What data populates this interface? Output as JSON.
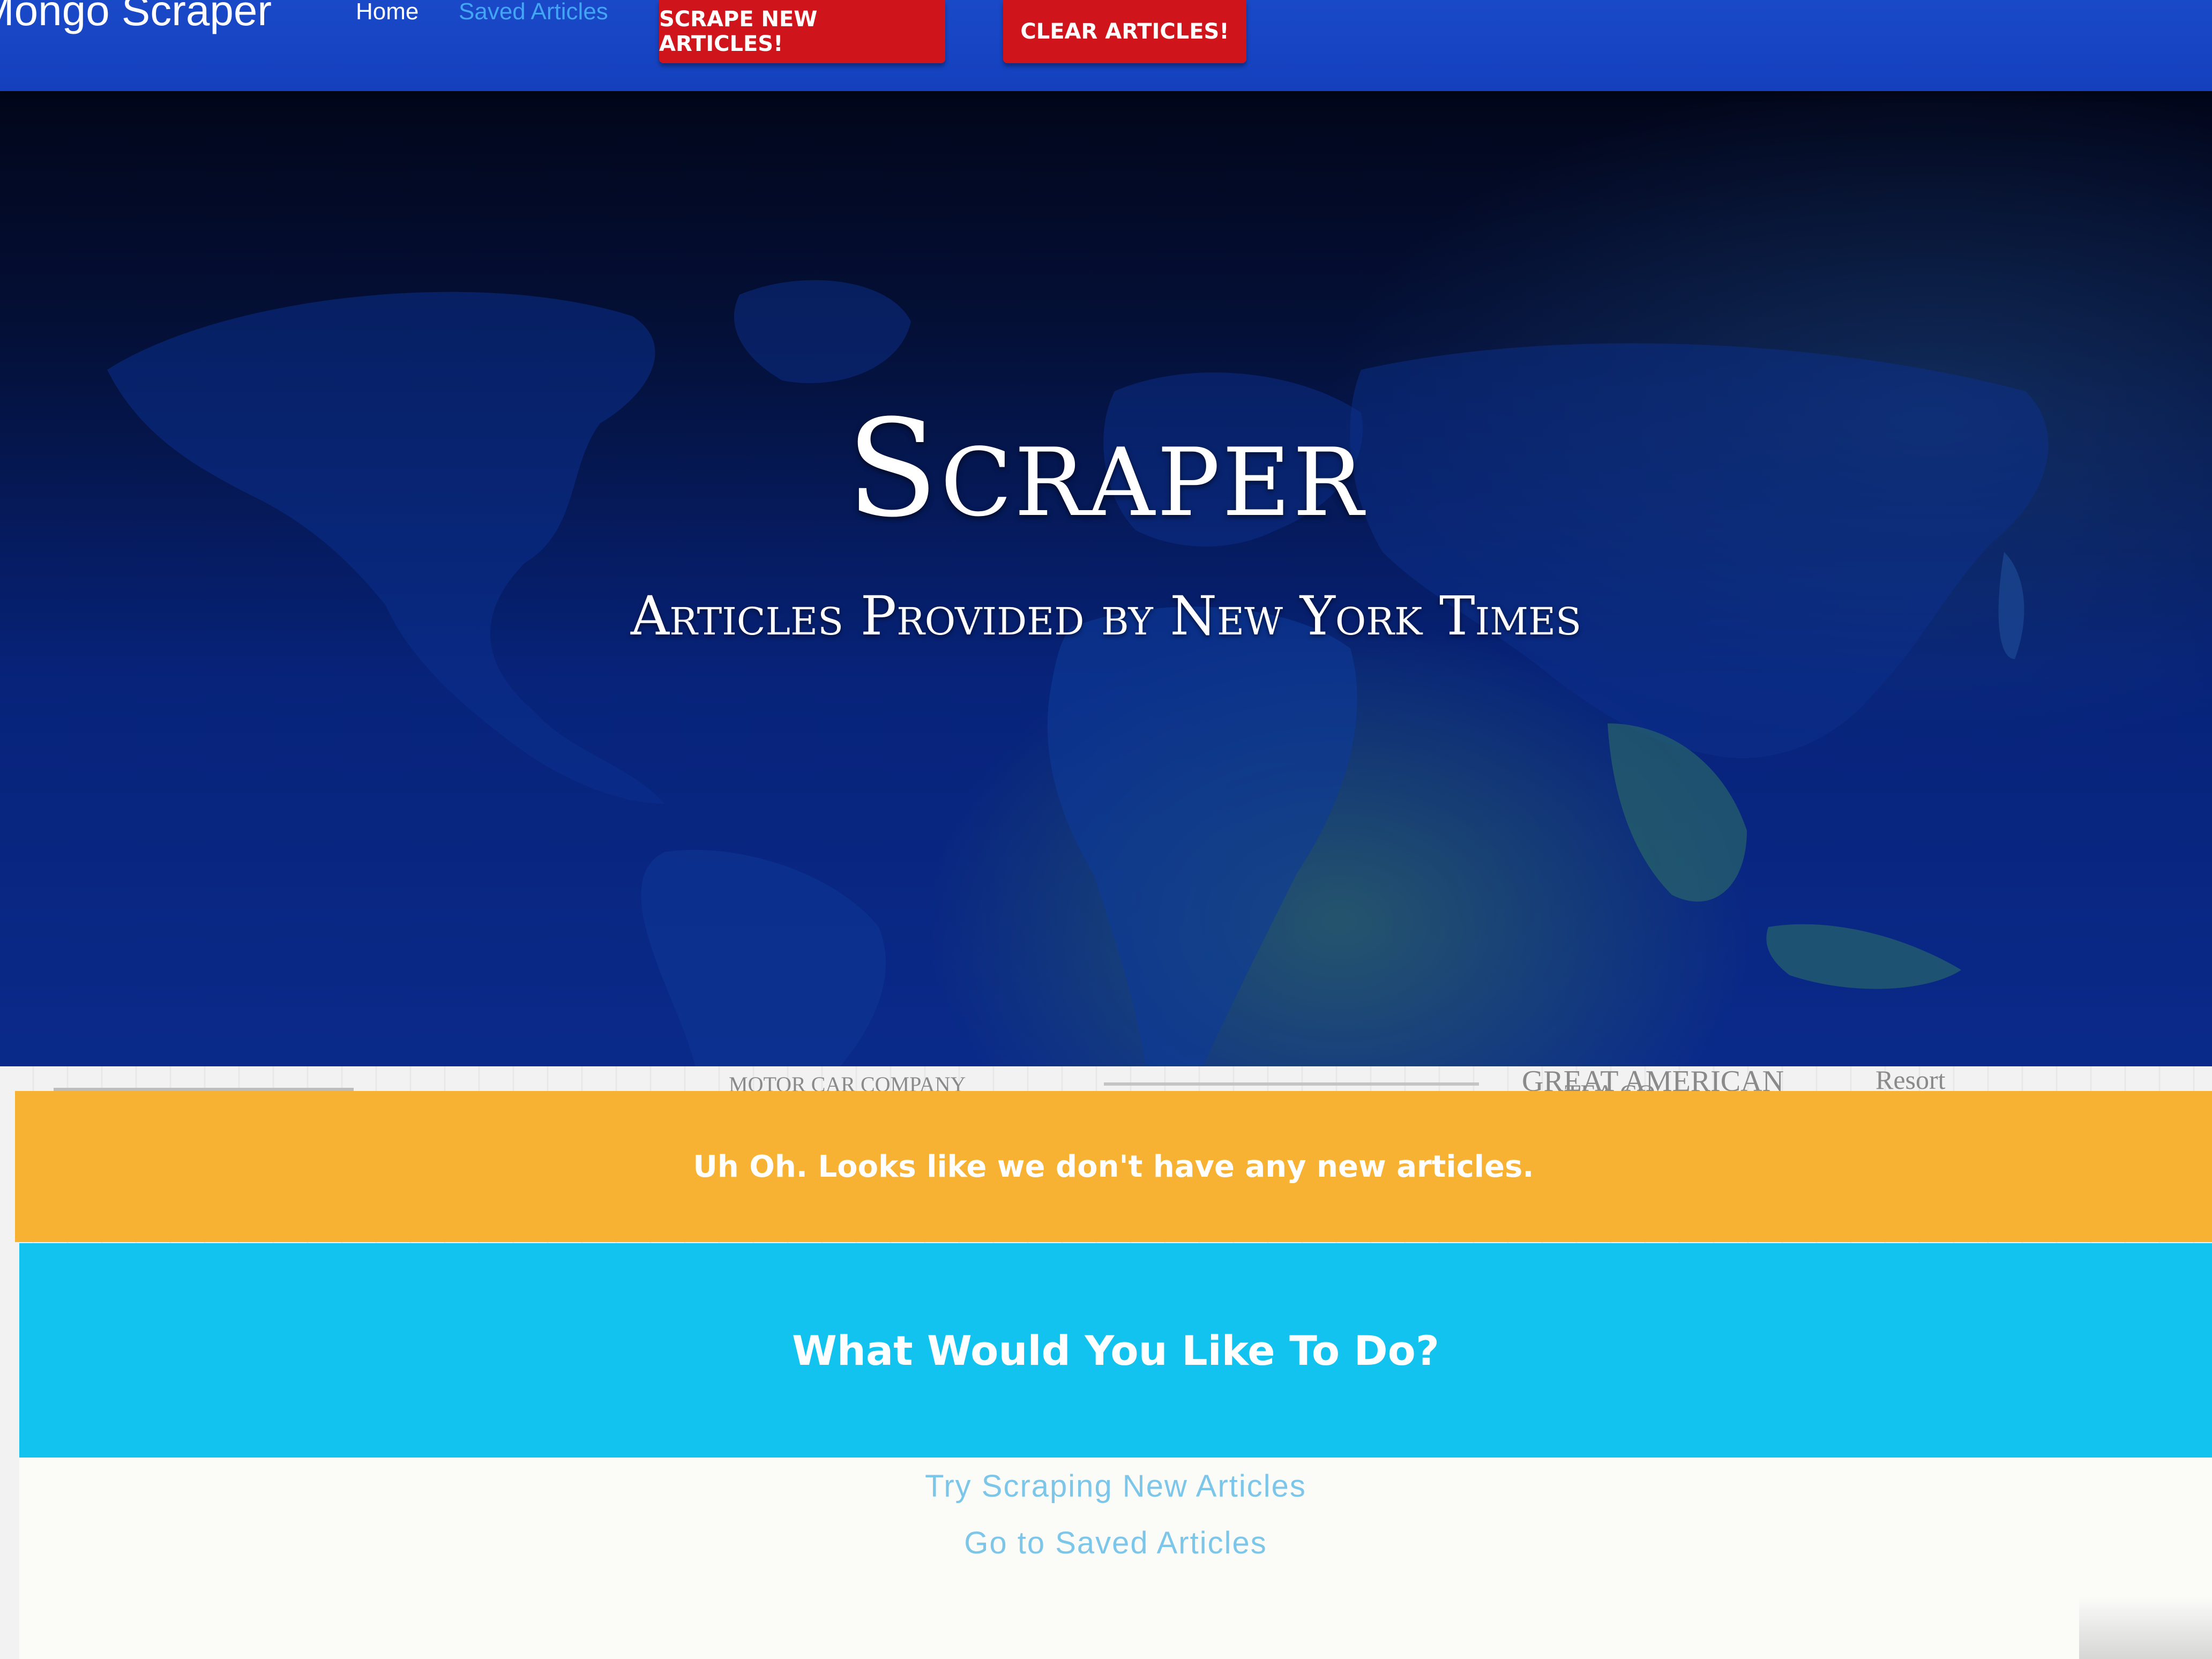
{
  "navbar": {
    "brand": "Mongo Scraper",
    "links": [
      {
        "label": "Home"
      },
      {
        "label": "Saved Articles"
      }
    ],
    "buttons": {
      "scrape_label": "SCRAPE NEW ARTICLES!",
      "clear_label": "CLEAR ARTICLES!"
    },
    "colors": {
      "navbar": "#1a49c8",
      "button": "#d0141c",
      "active_link": "#42a5f5"
    }
  },
  "hero": {
    "title": "Scraper",
    "subtitle": "Articles Provided by New York Times"
  },
  "background_print": {
    "snippets": [
      "MOTOR CAR COMPANY",
      "GREAT AMERICAN",
      "TEA CO.",
      "Resort"
    ]
  },
  "alert": {
    "message": "Uh Oh. Looks like we don't have any new articles.",
    "color": "#f7b233"
  },
  "actions_panel": {
    "heading": "What Would You Like To Do?",
    "heading_color": "#12c3ef",
    "links": [
      {
        "label": "Try Scraping New Articles"
      },
      {
        "label": "Go to Saved Articles"
      }
    ]
  }
}
